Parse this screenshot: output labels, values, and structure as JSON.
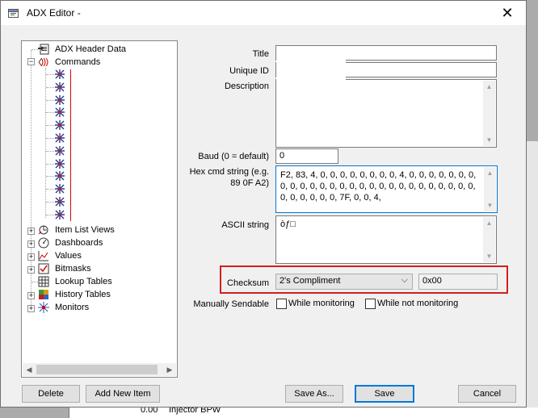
{
  "window": {
    "title": "ADX Editor -"
  },
  "tree": {
    "header_data": "ADX Header Data",
    "commands": "Commands",
    "item_list_views": "Item List Views",
    "dashboards": "Dashboards",
    "values": "Values",
    "bitmasks": "Bitmasks",
    "lookup_tables": "Lookup Tables",
    "history_tables": "History Tables",
    "monitors": "Monitors"
  },
  "form": {
    "title_label": "Title",
    "title_value": "",
    "unique_id_label": "Unique ID",
    "unique_id_value": "",
    "description_label": "Description",
    "description_value": "",
    "baud_label": "Baud (0 = default)",
    "baud_value": "0",
    "hex_label_1": "Hex cmd string (e.g.",
    "hex_label_2": "89 0F A2)",
    "hex_value": "F2, 83, 4, 0, 0, 0, 0, 0, 0, 0, 0, 4, 0, 0, 0, 0, 0, 0, 0, 0, 0, 0, 0, 0, 0, 0, 0, 0, 0, 0, 0, 0, 0, 0, 0, 0, 0, 0, 0, 0, 0, 0, 0, 0, 0, 7F, 0, 0, 4,",
    "ascii_label": "ASCII string",
    "ascii_value": "òƒ□",
    "checksum_label": "Checksum",
    "checksum_selected": "2's Compliment",
    "checksum_value": "0x00",
    "manually_sendable_label": "Manually Sendable",
    "while_monitoring": "While monitoring",
    "while_not_monitoring": "While not monitoring"
  },
  "buttons": {
    "delete": "Delete",
    "add_new_item": "Add New Item",
    "save_as": "Save As...",
    "save": "Save",
    "cancel": "Cancel"
  },
  "background": {
    "value": "0.00",
    "label": "Injector BPW"
  }
}
